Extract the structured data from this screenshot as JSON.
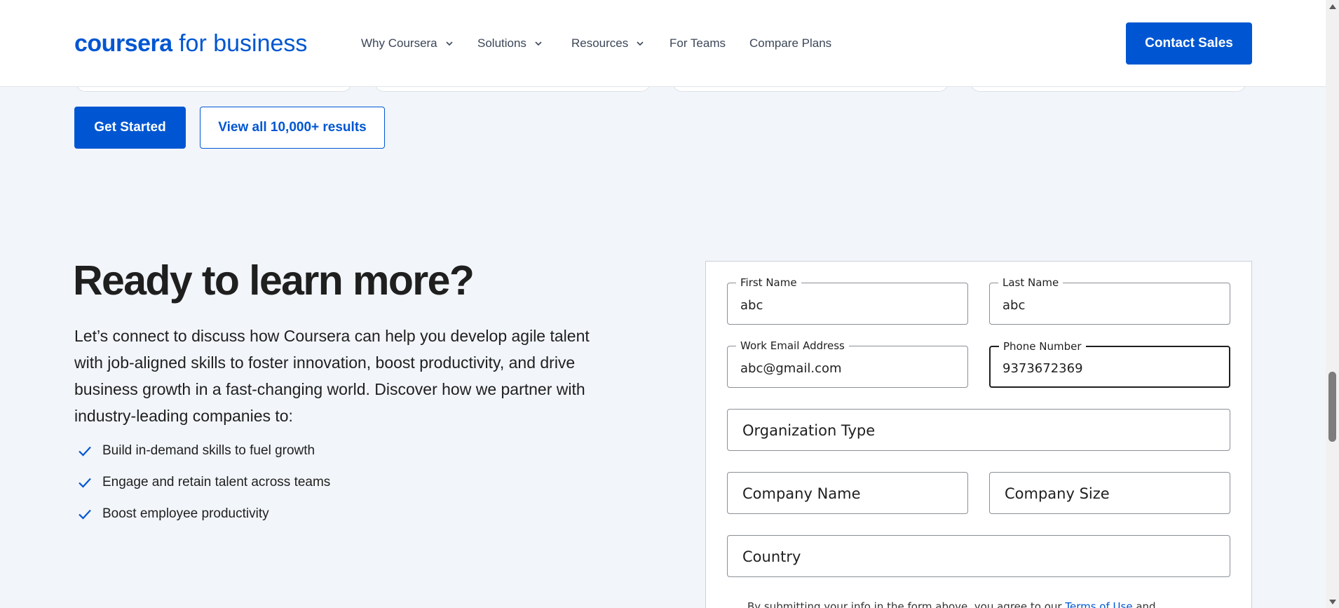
{
  "header": {
    "logo_brand": "coursera",
    "logo_suffix": "for business",
    "nav": [
      {
        "label": "Why Coursera",
        "dropdown": true
      },
      {
        "label": "Solutions",
        "dropdown": true
      },
      {
        "label": "Resources",
        "dropdown": true
      },
      {
        "label": "For Teams",
        "dropdown": false
      },
      {
        "label": "Compare Plans",
        "dropdown": false
      }
    ],
    "contact_label": "Contact Sales"
  },
  "cta": {
    "primary_label": "Get Started",
    "secondary_label": "View all 10,000+ results"
  },
  "intro": {
    "heading": "Ready to learn more?",
    "paragraph": "Let’s connect to discuss how Coursera can help you develop agile talent with job-aligned skills to foster innovation, boost productivity, and drive business growth in a fast-changing world. Discover how we partner with industry-leading companies to:",
    "bullets": [
      "Build in-demand skills to fuel growth",
      "Engage and retain talent across teams",
      "Boost employee productivity"
    ]
  },
  "form": {
    "first_name": {
      "label": "First Name",
      "value": "abc"
    },
    "last_name": {
      "label": "Last Name",
      "value": "abc"
    },
    "email": {
      "label": "Work Email Address",
      "value": "abc@gmail.com"
    },
    "phone": {
      "label": "Phone Number",
      "value": "9373672369"
    },
    "org_type": {
      "placeholder": "Organization Type"
    },
    "company_name": {
      "placeholder": "Company Name"
    },
    "company_size": {
      "placeholder": "Company Size"
    },
    "country": {
      "placeholder": "Country"
    },
    "disclaimer_prefix": "By submitting your info in the form above, you agree to our",
    "disclaimer_link": "Terms of Use",
    "disclaimer_suffix": "and"
  },
  "colors": {
    "accent": "#0056d2",
    "background": "#f2f5fa",
    "text": "#1f1f1f"
  },
  "icons": {
    "dropdown": "chevron-down-icon",
    "bullet": "check-icon"
  }
}
